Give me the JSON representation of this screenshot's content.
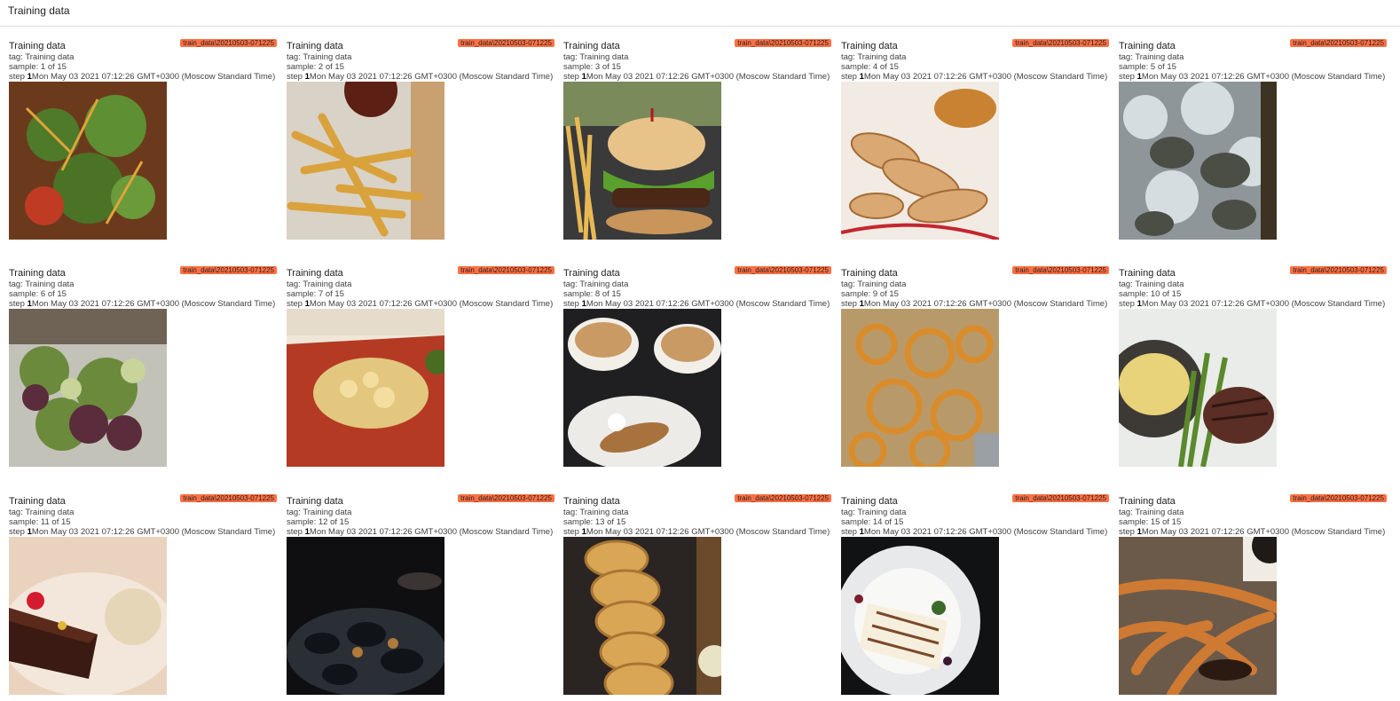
{
  "header": {
    "title": "Training data"
  },
  "cards": [
    {
      "title": "Training data",
      "run": "train_data\\20210503-071225",
      "tag": "tag: Training data",
      "sample": "sample: 1 of 15",
      "step_label": "step ",
      "step_value": "1",
      "timestamp": "Mon May 03 2021 07:12:26 GMT+0300 (Moscow Standard Time)",
      "image": "salad-with-arugula"
    },
    {
      "title": "Training data",
      "run": "train_data\\20210503-071225",
      "tag": "tag: Training data",
      "sample": "sample: 2 of 15",
      "step_label": "step ",
      "step_value": "1",
      "timestamp": "Mon May 03 2021 07:12:26 GMT+0300 (Moscow Standard Time)",
      "image": "french-fries"
    },
    {
      "title": "Training data",
      "run": "train_data\\20210503-071225",
      "tag": "tag: Training data",
      "sample": "sample: 3 of 15",
      "step_label": "step ",
      "step_value": "1",
      "timestamp": "Mon May 03 2021 07:12:26 GMT+0300 (Moscow Standard Time)",
      "image": "hamburger-with-fries"
    },
    {
      "title": "Training data",
      "run": "train_data\\20210503-071225",
      "tag": "tag: Training data",
      "sample": "sample: 4 of 15",
      "step_label": "step ",
      "step_value": "1",
      "timestamp": "Mon May 03 2021 07:12:26 GMT+0300 (Moscow Standard Time)",
      "image": "gyoza-dumplings"
    },
    {
      "title": "Training data",
      "run": "train_data\\20210503-071225",
      "tag": "tag: Training data",
      "sample": "sample: 5 of 15",
      "step_label": "step ",
      "step_value": "1",
      "timestamp": "Mon May 03 2021 07:12:26 GMT+0300 (Moscow Standard Time)",
      "image": "oysters-on-ice"
    },
    {
      "title": "Training data",
      "run": "train_data\\20210503-071225",
      "tag": "tag: Training data",
      "sample": "sample: 6 of 15",
      "step_label": "step ",
      "step_value": "1",
      "timestamp": "Mon May 03 2021 07:12:26 GMT+0300 (Moscow Standard Time)",
      "image": "green-salad"
    },
    {
      "title": "Training data",
      "run": "train_data\\20210503-071225",
      "tag": "tag: Training data",
      "sample": "sample: 7 of 15",
      "step_label": "step ",
      "step_value": "1",
      "timestamp": "Mon May 03 2021 07:12:26 GMT+0300 (Moscow Standard Time)",
      "image": "lasagna-tray"
    },
    {
      "title": "Training data",
      "run": "train_data\\20210503-071225",
      "tag": "tag: Training data",
      "sample": "sample: 8 of 15",
      "step_label": "step ",
      "step_value": "1",
      "timestamp": "Mon May 03 2021 07:12:26 GMT+0300 (Moscow Standard Time)",
      "image": "cappuccino-and-cannoli"
    },
    {
      "title": "Training data",
      "run": "train_data\\20210503-071225",
      "tag": "tag: Training data",
      "sample": "sample: 9 of 15",
      "step_label": "step ",
      "step_value": "1",
      "timestamp": "Mon May 03 2021 07:12:26 GMT+0300 (Moscow Standard Time)",
      "image": "fried-onion-strings"
    },
    {
      "title": "Training data",
      "run": "train_data\\20210503-071225",
      "tag": "tag: Training data",
      "sample": "sample: 10 of 15",
      "step_label": "step ",
      "step_value": "1",
      "timestamp": "Mon May 03 2021 07:12:26 GMT+0300 (Moscow Standard Time)",
      "image": "steak-with-asparagus"
    },
    {
      "title": "Training data",
      "run": "train_data\\20210503-071225",
      "tag": "tag: Training data",
      "sample": "sample: 11 of 15",
      "step_label": "step ",
      "step_value": "1",
      "timestamp": "Mon May 03 2021 07:12:26 GMT+0300 (Moscow Standard Time)",
      "image": "chocolate-cake-with-ice-cream"
    },
    {
      "title": "Training data",
      "run": "train_data\\20210503-071225",
      "tag": "tag: Training data",
      "sample": "sample: 12 of 15",
      "step_label": "step ",
      "step_value": "1",
      "timestamp": "Mon May 03 2021 07:12:26 GMT+0300 (Moscow Standard Time)",
      "image": "mussels-dark"
    },
    {
      "title": "Training data",
      "run": "train_data\\20210503-071225",
      "tag": "tag: Training data",
      "sample": "sample: 13 of 15",
      "step_label": "step ",
      "step_value": "1",
      "timestamp": "Mon May 03 2021 07:12:26 GMT+0300 (Moscow Standard Time)",
      "image": "onion-rings-tower"
    },
    {
      "title": "Training data",
      "run": "train_data\\20210503-071225",
      "tag": "tag: Training data",
      "sample": "sample: 14 of 15",
      "step_label": "step ",
      "step_value": "1",
      "timestamp": "Mon May 03 2021 07:12:26 GMT+0300 (Moscow Standard Time)",
      "image": "cheesecake-plate"
    },
    {
      "title": "Training data",
      "run": "train_data\\20210503-071225",
      "tag": "tag: Training data",
      "sample": "sample: 15 of 15",
      "step_label": "step ",
      "step_value": "1",
      "timestamp": "Mon May 03 2021 07:12:26 GMT+0300 (Moscow Standard Time)",
      "image": "churros"
    }
  ]
}
